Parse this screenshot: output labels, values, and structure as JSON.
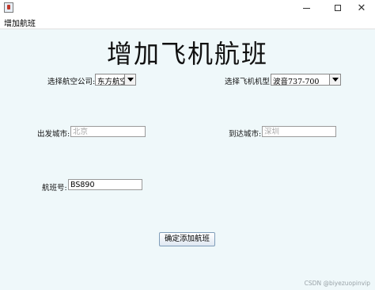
{
  "window": {
    "title_icon": "java-cup-icon",
    "controls": {
      "minimize": "─",
      "maximize": "□",
      "close": "✕"
    }
  },
  "menubar": {
    "item": "增加航班"
  },
  "form": {
    "heading": "增加飞机航班",
    "airline_label": "选择航空公司:",
    "airline_value": "东方航空",
    "aircraft_label": "选择飞机机型:",
    "aircraft_value": "波音737-700",
    "departure_label": "出发城市:",
    "departure_placeholder": "北京",
    "arrival_label": "到达城市:",
    "arrival_placeholder": "深圳",
    "flight_label": "航班号:",
    "flight_value": "BS890",
    "submit_label": "确定添加航班"
  },
  "watermark": "CSDN @biyezuopinvip"
}
